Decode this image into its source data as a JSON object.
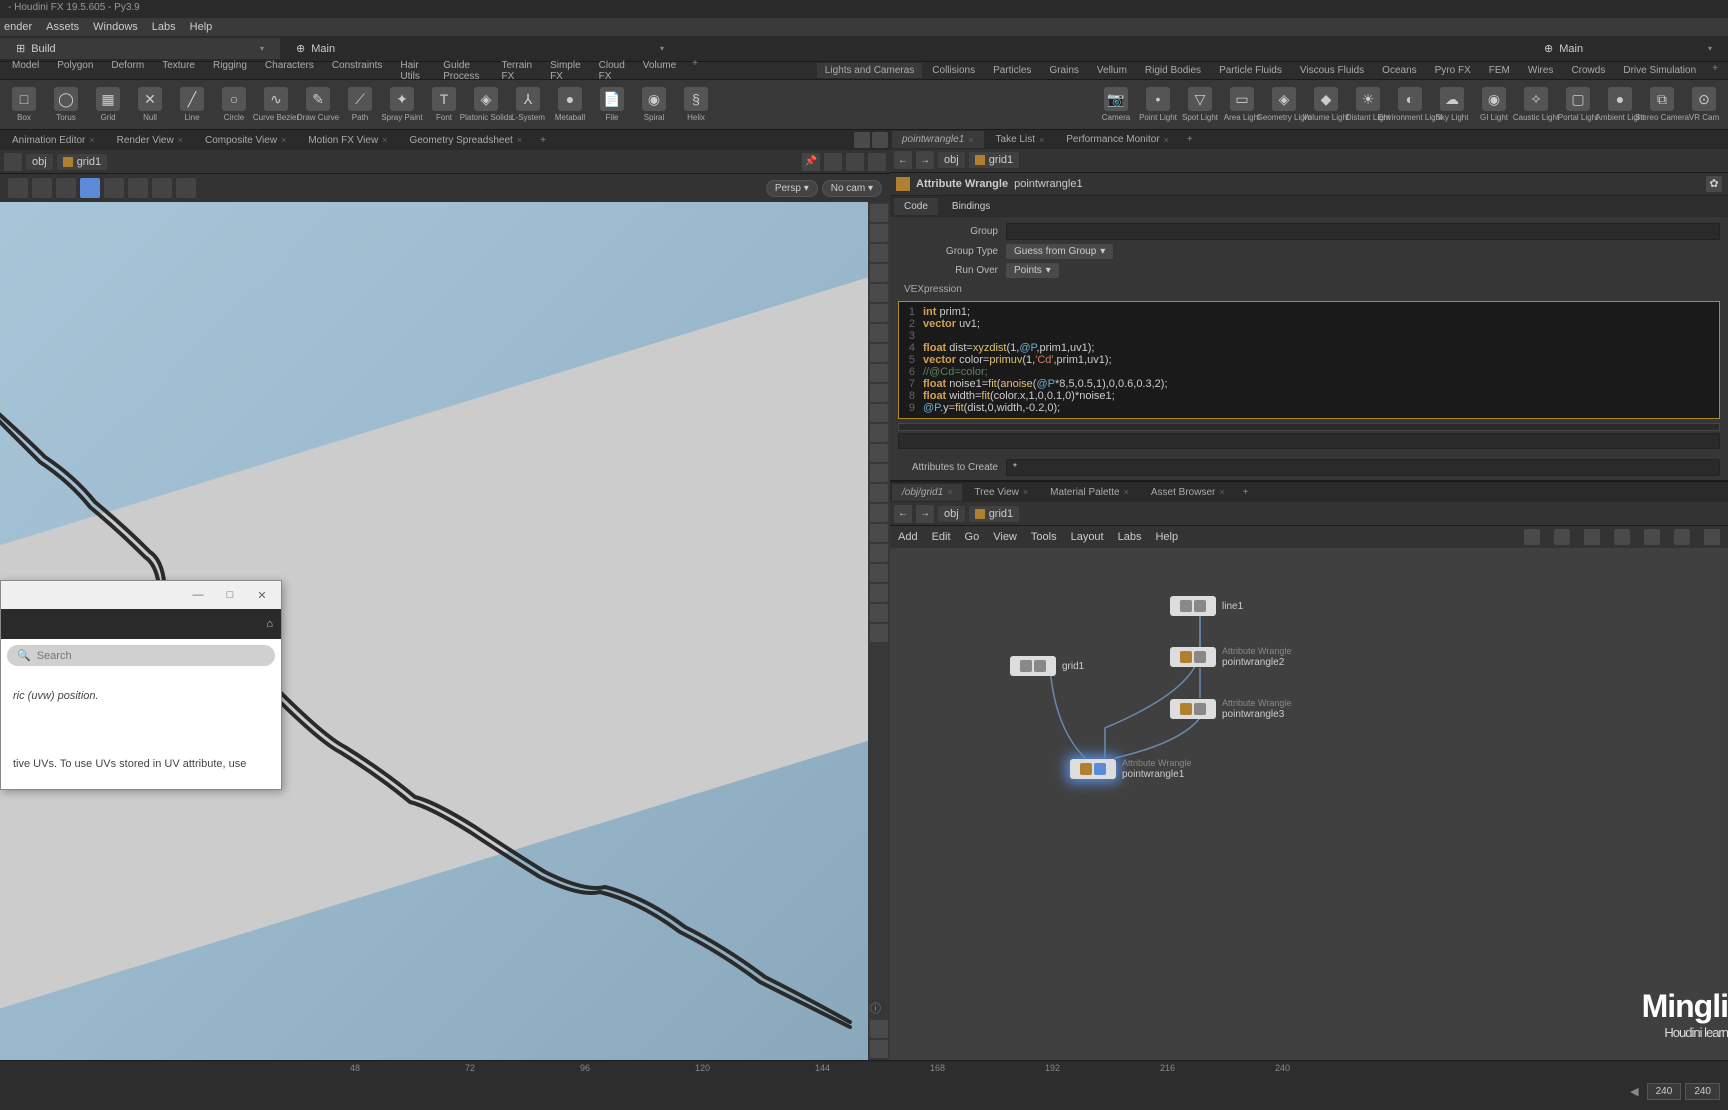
{
  "title": "- Houdini FX 19.5.605 - Py3.9",
  "mainmenu": [
    "ender",
    "Assets",
    "Windows",
    "Labs",
    "Help"
  ],
  "desktabs": [
    {
      "icon": "⊞",
      "label": "Build"
    },
    {
      "icon": "⊕",
      "label": "Main"
    },
    {
      "icon": "⊕",
      "label": "Main"
    }
  ],
  "shelfTabsLeft": [
    "Model",
    "Polygon",
    "Deform",
    "Texture",
    "Rigging",
    "Characters",
    "Constraints",
    "Hair Utils",
    "Guide Process",
    "Terrain FX",
    "Simple FX",
    "Cloud FX",
    "Volume"
  ],
  "shelfTabsRight": [
    "Lights and Cameras",
    "Collisions",
    "Particles",
    "Grains",
    "Vellum",
    "Rigid Bodies",
    "Particle Fluids",
    "Viscous Fluids",
    "Oceans",
    "Pyro FX",
    "FEM",
    "Wires",
    "Crowds",
    "Drive Simulation"
  ],
  "toolsLeft": [
    {
      "label": "Box",
      "glyph": "□"
    },
    {
      "label": "Torus",
      "glyph": "◯"
    },
    {
      "label": "Grid",
      "glyph": "▦"
    },
    {
      "label": "Null",
      "glyph": "✕"
    },
    {
      "label": "Line",
      "glyph": "╱"
    },
    {
      "label": "Circle",
      "glyph": "○"
    },
    {
      "label": "Curve Bezier",
      "glyph": "∿"
    },
    {
      "label": "Draw Curve",
      "glyph": "✎"
    },
    {
      "label": "Path",
      "glyph": "⟋"
    },
    {
      "label": "Spray Paint",
      "glyph": "✦"
    },
    {
      "label": "Font",
      "glyph": "T"
    },
    {
      "label": "Platonic Solids",
      "glyph": "◈"
    },
    {
      "label": "L-System",
      "glyph": "⅄"
    },
    {
      "label": "Metaball",
      "glyph": "●"
    },
    {
      "label": "File",
      "glyph": "📄"
    },
    {
      "label": "Spiral",
      "glyph": "◉"
    },
    {
      "label": "Helix",
      "glyph": "§"
    }
  ],
  "toolsRight": [
    {
      "label": "Camera",
      "glyph": "📷"
    },
    {
      "label": "Point Light",
      "glyph": "•"
    },
    {
      "label": "Spot Light",
      "glyph": "▽"
    },
    {
      "label": "Area Light",
      "glyph": "▭"
    },
    {
      "label": "Geometry Light",
      "glyph": "◈"
    },
    {
      "label": "Volume Light",
      "glyph": "◆"
    },
    {
      "label": "Distant Light",
      "glyph": "☀"
    },
    {
      "label": "Environment Light",
      "glyph": "◐"
    },
    {
      "label": "Sky Light",
      "glyph": "☁"
    },
    {
      "label": "GI Light",
      "glyph": "◉"
    },
    {
      "label": "Caustic Light",
      "glyph": "✧"
    },
    {
      "label": "Portal Light",
      "glyph": "▢"
    },
    {
      "label": "Ambient Light",
      "glyph": "●"
    },
    {
      "label": "Stereo Camera",
      "glyph": "⧉"
    },
    {
      "label": "VR Cam",
      "glyph": "⊙"
    }
  ],
  "leftPaneTabs": [
    "Animation Editor",
    "Render View",
    "Composite View",
    "Motion FX View",
    "Geometry Spreadsheet"
  ],
  "rightPaneTabs": [
    "pointwrangle1",
    "Take List",
    "Performance Monitor"
  ],
  "leftPath": {
    "obj": "obj",
    "node": "grid1"
  },
  "rightPath": {
    "obj": "obj",
    "node": "grid1"
  },
  "viewportControls": {
    "persp": "Persp ▾",
    "cam": "No cam ▾"
  },
  "paramHeader": {
    "type": "Attribute Wrangle",
    "name": "pointwrangle1"
  },
  "paramTabs": [
    "Code",
    "Bindings"
  ],
  "params": {
    "groupLabel": "Group",
    "groupTypeLabel": "Group Type",
    "groupType": "Guess from Group",
    "runOverLabel": "Run Over",
    "runOver": "Points",
    "vexLabel": "VEXpression",
    "attrCreateLabel": "Attributes to Create",
    "attrCreate": "*"
  },
  "code": [
    {
      "n": 1,
      "tokens": [
        [
          "keyword",
          "int"
        ],
        [
          "text",
          " prim1;"
        ]
      ]
    },
    {
      "n": 2,
      "tokens": [
        [
          "keyword",
          "vector"
        ],
        [
          "text",
          " uv1;"
        ]
      ]
    },
    {
      "n": 3,
      "tokens": []
    },
    {
      "n": 4,
      "tokens": [
        [
          "keyword",
          "float"
        ],
        [
          "text",
          " dist="
        ],
        [
          "func",
          "xyzdist"
        ],
        [
          "text",
          "(1,"
        ],
        [
          "var",
          "@P"
        ],
        [
          "text",
          ",prim1,uv1);"
        ]
      ]
    },
    {
      "n": 5,
      "tokens": [
        [
          "keyword",
          "vector"
        ],
        [
          "text",
          " color="
        ],
        [
          "func",
          "primuv"
        ],
        [
          "text",
          "(1,"
        ],
        [
          "str",
          "'Cd'"
        ],
        [
          "text",
          ",prim1,uv1);"
        ]
      ]
    },
    {
      "n": 6,
      "tokens": [
        [
          "comment",
          "//@Cd=color;"
        ]
      ]
    },
    {
      "n": 7,
      "tokens": [
        [
          "keyword",
          "float"
        ],
        [
          "text",
          " noise1="
        ],
        [
          "func",
          "fit"
        ],
        [
          "text",
          "("
        ],
        [
          "func",
          "anoise"
        ],
        [
          "text",
          "("
        ],
        [
          "var",
          "@P"
        ],
        [
          "text",
          "*8,5,0.5,1),0,0.6,0.3,2);"
        ]
      ]
    },
    {
      "n": 8,
      "tokens": [
        [
          "keyword",
          "float"
        ],
        [
          "text",
          " width="
        ],
        [
          "func",
          "fit"
        ],
        [
          "text",
          "(color.x,1,0,0.1,0)*noise1;"
        ]
      ]
    },
    {
      "n": 9,
      "tokens": [
        [
          "var",
          "@P"
        ],
        [
          "text",
          ".y="
        ],
        [
          "func",
          "fit"
        ],
        [
          "text",
          "(dist,0,width,-0.2,0);"
        ]
      ]
    }
  ],
  "networkTabs": [
    "/obj/grid1",
    "Tree View",
    "Material Palette",
    "Asset Browser"
  ],
  "networkPath": {
    "obj": "obj",
    "node": "grid1"
  },
  "networkMenu": [
    "Add",
    "Edit",
    "Go",
    "View",
    "Tools",
    "Layout",
    "Labs",
    "Help"
  ],
  "nodes": {
    "line1": {
      "label": "line1",
      "type": ""
    },
    "grid1": {
      "label": "grid1",
      "type": ""
    },
    "pw2": {
      "label": "pointwrangle2",
      "type": "Attribute Wrangle"
    },
    "pw3": {
      "label": "pointwrangle3",
      "type": "Attribute Wrangle"
    },
    "pw1": {
      "label": "pointwrangle1",
      "type": "Attribute Wrangle"
    }
  },
  "timeline": {
    "ticks": [
      "48",
      "72",
      "96",
      "120",
      "144",
      "168",
      "192",
      "216",
      "240"
    ],
    "frame1": "240",
    "frame2": "240"
  },
  "popup": {
    "searchPlaceholder": "Search",
    "text1": "ric (uvw) position.",
    "text2": "tive UVs. To use UVs stored in UV attribute, use"
  },
  "watermark": {
    "main": "Mingli",
    "sub": "Houdini learn"
  }
}
